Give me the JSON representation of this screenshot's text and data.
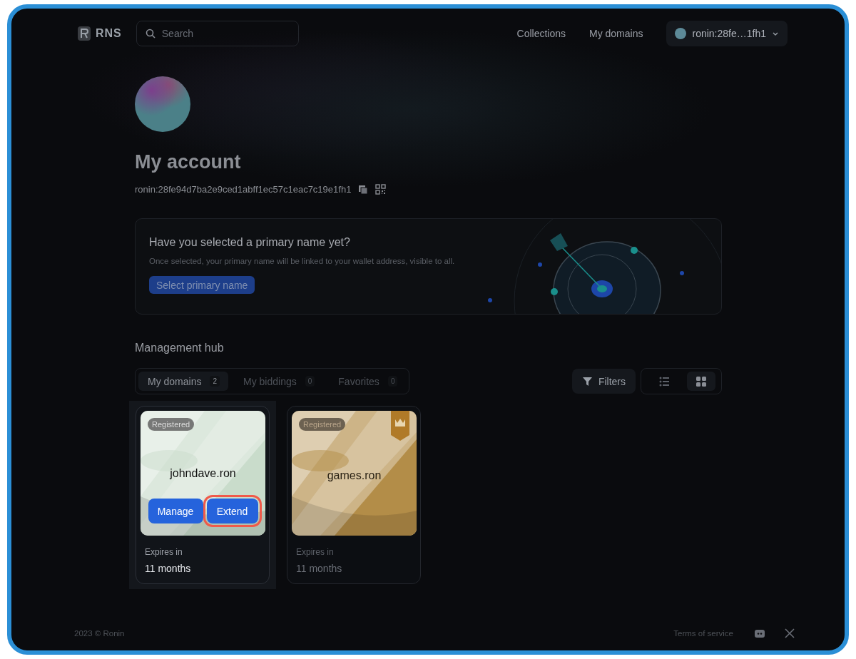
{
  "header": {
    "logo": "RNS",
    "search": {
      "placeholder": "Search"
    },
    "nav": [
      "Collections",
      "My domains"
    ],
    "account": "ronin:28fe…1fh1"
  },
  "profile": {
    "title": "My account",
    "address": "ronin:28fe94d7ba2e9ced1abff1ec57c1eac7c19e1fh1"
  },
  "banner": {
    "title": "Have you selected a primary name yet?",
    "text": "Once selected, your primary name will be linked to your wallet address, visible to all.",
    "button": "Select primary name"
  },
  "hub": {
    "title": "Management hub",
    "tabs": [
      {
        "label": "My domains",
        "count": "2",
        "selected": true
      },
      {
        "label": "My biddings",
        "count": "0",
        "selected": false
      },
      {
        "label": "Favorites",
        "count": "0",
        "selected": false
      }
    ],
    "filters": "Filters",
    "views": [
      {
        "kind": "list",
        "selected": false
      },
      {
        "kind": "grid",
        "selected": true
      }
    ]
  },
  "domains": [
    {
      "name": "johndave.ron",
      "status": "Registered",
      "color": "#c9dccb",
      "crown": false,
      "focused": true,
      "actions": [
        {
          "label": "Manage",
          "highlighted": false
        },
        {
          "label": "Extend",
          "highlighted": true
        }
      ],
      "expires_label": "Expires in",
      "expires_value": "11 months"
    },
    {
      "name": "games.ron",
      "status": "Registered",
      "color": "#b38d48",
      "crown": true,
      "focused": false,
      "expires_label": "Expires in",
      "expires_value": "11 months"
    }
  ],
  "footer": {
    "copyright": "2023 © Ronin",
    "link": "Terms of service"
  }
}
